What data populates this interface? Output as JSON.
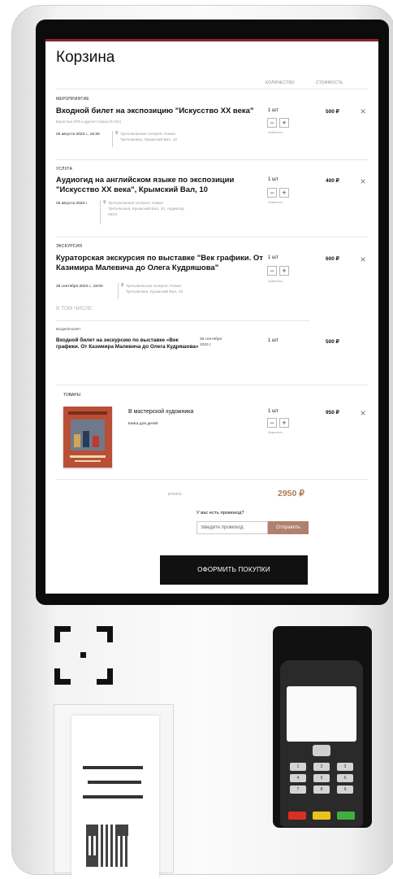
{
  "cart": {
    "title": "Корзина",
    "col_quantity": "КОЛИЧЕСТВО",
    "col_cost": "СТОИМОСТЬ",
    "stepper_minus": "−",
    "stepper_plus": "+",
    "change_label": "Изменить",
    "remove_glyph": "×",
    "pin_glyph": "⚲",
    "items": [
      {
        "category": "МЕРОПРИЯТИЕ",
        "title": "Входной билет на экспозицию \"Искусство XX века\"",
        "subtitle": "Взрослые (РФ и другие страны ЕАЭС)",
        "date": "26 августа 2023 г., 16:30",
        "address": "Третьяковская галерея, Новая Третьяковка, Крымский Вал, 10",
        "quantity": "1 шт",
        "price": "500 ₽"
      },
      {
        "category": "УСЛУГА",
        "title": "Аудиогид на английском языке по экспозиции \"Искусство XX века\", Крымский Вал, 10",
        "date": "26 августа 2023 г.",
        "address": "Третьяковская галерея, Новая Третьяковка, Крымский Вал, 10, Аудиогид КВ10",
        "quantity": "1 шт",
        "price": "400 ₽"
      },
      {
        "category": "ЭКСКУРСИЯ",
        "title": "Кураторская экскурсия по выставке \"Век графики. От Казимира Малевича до Олега Кудряшова\"",
        "date": "28 сентября 2023 г., 19:00",
        "address": "Третьяковская галерея, Новая Третьяковка, Крымский Вал, 10",
        "quantity": "1 шт",
        "price": "600 ₽",
        "included_label": "В ТОМ ЧИСЛЕ:",
        "included": {
          "category": "ВХОДНОЙ БИЛЕТ",
          "title": "Входной билет на экскурсию по выставке «Век графики. От Казимира Малевича до Олега Кудряшова»",
          "date": "28 сентября 2023 г.",
          "quantity": "1 шт",
          "price": "500 ₽"
        }
      }
    ],
    "goods": {
      "heading": "ТОВАРЫ",
      "title": "В мастерской художника",
      "subtitle": "Книга для детей",
      "quantity": "1 шт",
      "price": "950 ₽"
    },
    "total_label": "ИТОГО:",
    "total_value": "2950 ₽",
    "promo_question": "У вас есть промокод?",
    "promo_placeholder": "Введите промокод",
    "promo_submit": "Отправить",
    "checkout_button": "ОФОРМИТЬ ПОКУПКИ"
  },
  "terminal": {
    "keys": [
      "1",
      "2",
      "3",
      "4",
      "5",
      "6",
      "7",
      "8",
      "9"
    ],
    "fn_colors": [
      "#d93025",
      "#e8c21a",
      "#3fae3f"
    ]
  }
}
